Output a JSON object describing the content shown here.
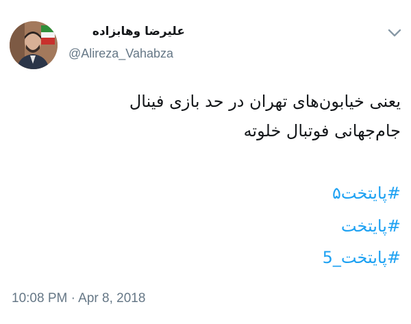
{
  "tweet": {
    "author_name": "علیرضا وهابزاده",
    "author_handle": "@Alireza_Vahabza",
    "text_line_1": "یعنی خیابون‌های تهران در حد بازی فینال",
    "text_line_2": "جام‌جهانی فوتبال خلوته",
    "hashtags": [
      "#پایتخت۵",
      "#پایتخت",
      "#پایتخت_5"
    ],
    "timestamp": "10:08 PM · Apr 8, 2018"
  },
  "colors": {
    "hashtag": "#1da1f2",
    "secondary_text": "#657786",
    "primary_text": "#14171a"
  },
  "icons": {
    "menu": "chevron-down-icon"
  }
}
